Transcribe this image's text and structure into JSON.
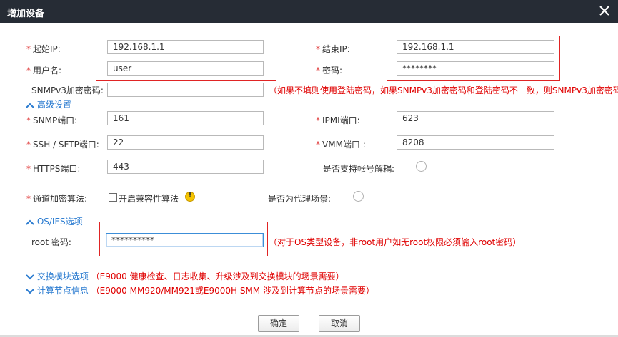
{
  "dialog": {
    "title": "增加设备",
    "close_icon": "close-icon"
  },
  "fields": {
    "start_ip": {
      "label": "起始IP:",
      "value": "192.168.1.1"
    },
    "end_ip": {
      "label": "结束IP:",
      "value": "192.168.1.1"
    },
    "username": {
      "label": "用户名:",
      "value": "user"
    },
    "password": {
      "label": "密码:",
      "value": "********"
    },
    "snmpv3_password": {
      "label": "SNMPv3加密密码:",
      "value": "",
      "note": "（如果不填则使用登陆密码，如果SNMPv3加密密码和登陆密码不一致，则SNMPv3加密密码必..."
    },
    "snmp_port": {
      "label": "SNMP端口:",
      "value": "161"
    },
    "ipmi_port": {
      "label": "IPMI端口:",
      "value": "623"
    },
    "ssh_port": {
      "label": "SSH / SFTP端口:",
      "value": "22"
    },
    "vmm_port": {
      "label": "VMM端口 :",
      "value": "8208"
    },
    "https_port": {
      "label": "HTTPS端口:",
      "value": "443"
    },
    "account_decouple": {
      "label": "是否支持帐号解耦:"
    },
    "channel_encryption": {
      "label": "通道加密算法:",
      "checkbox_label": "开启兼容性算法"
    },
    "proxy_scenario": {
      "label": "是否为代理场景:"
    },
    "root_password": {
      "label": "root 密码:",
      "value": "**********",
      "note": "（对于OS类型设备，非root用户如无root权限必须输入root密码）"
    }
  },
  "sections": {
    "advanced": "高级设置",
    "os_ies": "OS/IES选项",
    "switch_module": {
      "label": "交换模块选项",
      "note": "（E9000 健康检查、日志收集、升级涉及到交换模块的场景需要）"
    },
    "compute_node": {
      "label": "计算节点信息",
      "note": "（E9000 MM920/MM921或E9000H SMM 涉及到计算节点的场景需要）"
    }
  },
  "required_marker": "*",
  "buttons": {
    "ok": "确定",
    "cancel": "取消"
  },
  "colors": {
    "titlebar": "#262c35",
    "required": "#e03c3c",
    "note": "#e00000",
    "section_link": "#2a7bd0",
    "highlight_box": "#e02424"
  }
}
